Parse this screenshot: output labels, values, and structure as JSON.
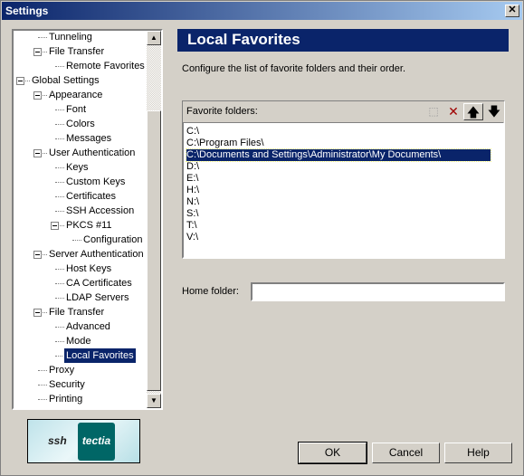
{
  "window": {
    "title": "Settings",
    "close": "✕"
  },
  "tree": {
    "items": [
      {
        "label": "Tunneling",
        "level": 1,
        "expander": false
      },
      {
        "label": "File Transfer",
        "level": 1,
        "expander": true
      },
      {
        "label": "Remote Favorites",
        "level": 2,
        "expander": false
      },
      {
        "label": "Global Settings",
        "level": 0,
        "expander": true
      },
      {
        "label": "Appearance",
        "level": 1,
        "expander": true
      },
      {
        "label": "Font",
        "level": 2,
        "expander": false
      },
      {
        "label": "Colors",
        "level": 2,
        "expander": false
      },
      {
        "label": "Messages",
        "level": 2,
        "expander": false
      },
      {
        "label": "User Authentication",
        "level": 1,
        "expander": true
      },
      {
        "label": "Keys",
        "level": 2,
        "expander": false
      },
      {
        "label": "Custom Keys",
        "level": 2,
        "expander": false
      },
      {
        "label": "Certificates",
        "level": 2,
        "expander": false
      },
      {
        "label": "SSH Accession",
        "level": 2,
        "expander": false
      },
      {
        "label": "PKCS #11",
        "level": 2,
        "expander": true
      },
      {
        "label": "Configuration",
        "level": 3,
        "expander": false
      },
      {
        "label": "Server Authentication",
        "level": 1,
        "expander": true
      },
      {
        "label": "Host Keys",
        "level": 2,
        "expander": false
      },
      {
        "label": "CA Certificates",
        "level": 2,
        "expander": false
      },
      {
        "label": "LDAP Servers",
        "level": 2,
        "expander": false
      },
      {
        "label": "File Transfer",
        "level": 1,
        "expander": true
      },
      {
        "label": "Advanced",
        "level": 2,
        "expander": false
      },
      {
        "label": "Mode",
        "level": 2,
        "expander": false
      },
      {
        "label": "Local Favorites",
        "level": 2,
        "expander": false,
        "selected": true
      },
      {
        "label": "Proxy",
        "level": 1,
        "expander": false
      },
      {
        "label": "Security",
        "level": 1,
        "expander": false
      },
      {
        "label": "Printing",
        "level": 1,
        "expander": false
      }
    ]
  },
  "logo": {
    "left": "ssh",
    "right": "tectia"
  },
  "panel": {
    "title": "Local Favorites",
    "description": "Configure the list of favorite folders and their order.",
    "favorites_label": "Favorite folders:",
    "toolbar": [
      {
        "icon": "new-folder-icon",
        "glyph": "⬚"
      },
      {
        "icon": "delete-icon",
        "glyph": "✕"
      },
      {
        "icon": "move-up-icon",
        "glyph": "🡅"
      },
      {
        "icon": "move-down-icon",
        "glyph": "🡇"
      }
    ],
    "folders": [
      "C:\\",
      "C:\\Program Files\\",
      "C:\\Documents and Settings\\Administrator\\My Documents\\",
      "D:\\",
      "E:\\",
      "H:\\",
      "N:\\",
      "S:\\",
      "T:\\",
      "V:\\"
    ],
    "selected_folder": 2,
    "home_label": "Home folder:",
    "home_value": ""
  },
  "buttons": {
    "ok": "OK",
    "cancel": "Cancel",
    "help": "Help"
  }
}
